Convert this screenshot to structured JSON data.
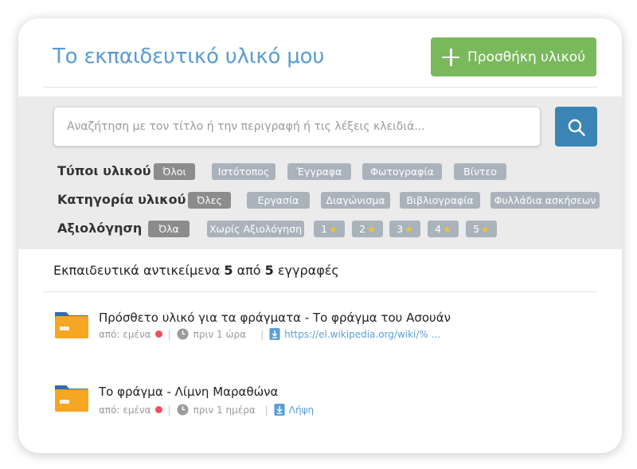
{
  "header": {
    "title": "Το εκπαιδευτικό υλικό μου",
    "add_button_label": "Προσθήκη υλικού"
  },
  "search": {
    "placeholder": "Αναζήτηση με τον τίτλο ή την περιγραφή ή τις λέξεις κλειδιά..."
  },
  "filters": {
    "types": {
      "label": "Τύποι υλικού",
      "chips": [
        "Όλοι",
        "Ιστότοπος",
        "Έγγραφα",
        "Φωτογραφία",
        "Βίντεο"
      ]
    },
    "categories": {
      "label": "Κατηγορία υλικού",
      "chips": [
        "Όλες",
        "Εργασία",
        "Διαγώνισμα",
        "Βιβλιογραφία",
        "Φυλλάδια ασκήσεων"
      ]
    },
    "rating": {
      "label": "Αξιολόγηση",
      "chips": [
        "Όλα",
        "Χωρίς Αξιολόγηση",
        "1",
        "2",
        "3",
        "4",
        "5"
      ]
    }
  },
  "results": {
    "prefix": "Εκπαιδευτικά αντικείμενα",
    "shown": "5",
    "middle": "από",
    "total": "5",
    "suffix": "εγγραφές"
  },
  "items": [
    {
      "title": "Πρόσθετο υλικό για τα φράγματα - Το φράγμα του Ασουάν",
      "author": "από: εμένα",
      "time": "πριν 1 ώρα",
      "link": "https://el.wikipedia.org/wiki/% ..."
    },
    {
      "title": "Το φράγμα - Λίμνη Μαραθώνα",
      "author": "από: εμένα",
      "time": "πριν 1 ημέρα",
      "link": "Λήψη"
    }
  ],
  "colors": {
    "title": "#5b9bd1",
    "add_button": "#7ab85c",
    "search_button": "#3a85b6",
    "chip": "#aab3bc",
    "chip_active": "#8c8c8c",
    "status_dot": "#f04e5a",
    "folder": "#f5a623"
  },
  "icons": {
    "add": "plus-icon",
    "search": "search-icon",
    "star": "star-icon",
    "folder": "folder-icon",
    "clock": "clock-icon",
    "download": "download-icon"
  }
}
